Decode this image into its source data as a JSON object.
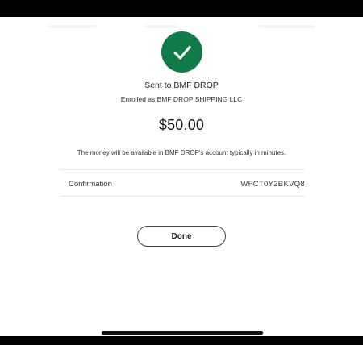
{
  "confirmation_screen": {
    "recipient_line": "Sent to BMF DROP",
    "enrolled_line": "Enrolled as BMF DROP SHIPPING LLC",
    "amount": "$50.00",
    "availability_note": "The money will be available in BMF DROP's account typically in minutes.",
    "confirmation": {
      "label": "Confirmation",
      "value": "WFCT0Y2BKVQ8"
    },
    "done_label": "Done"
  },
  "icons": {
    "status": "checkmark-circle-icon"
  },
  "colors": {
    "success_green": "#107a49",
    "background": "#ffffff",
    "frame": "#000000",
    "text": "#222222",
    "divider": "#e6e6e6"
  }
}
